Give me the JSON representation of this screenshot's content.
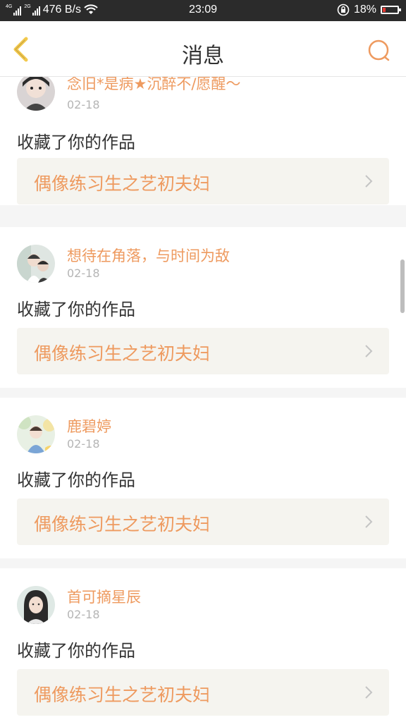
{
  "status_bar": {
    "net_tag_1": "4G",
    "net_tag_2": "2G",
    "speed": "476 B/s",
    "time": "23:09",
    "battery_pct": "18%",
    "battery_color": "#e53935"
  },
  "header": {
    "title": "消息",
    "back_icon": "chevron-left-icon",
    "search_icon": "search-icon"
  },
  "messages": [
    {
      "user": "念旧*是病★沉醉不/愿醒～",
      "date": "02-18",
      "action": "收藏了你的作品",
      "work": "偶像练习生之艺初夫妇"
    },
    {
      "user": "想待在角落，与时间为敌",
      "date": "02-18",
      "action": "收藏了你的作品",
      "work": "偶像练习生之艺初夫妇"
    },
    {
      "user": "鹿碧婷",
      "date": "02-18",
      "action": "收藏了你的作品",
      "work": "偶像练习生之艺初夫妇"
    },
    {
      "user": "首可摘星辰",
      "date": "02-18",
      "action": "收藏了你的作品",
      "work": "偶像练习生之艺初夫妇"
    }
  ],
  "colors": {
    "accent": "#ee9a5f",
    "back_icon": "#f2c94c",
    "work_bg": "#f5f4ef"
  }
}
